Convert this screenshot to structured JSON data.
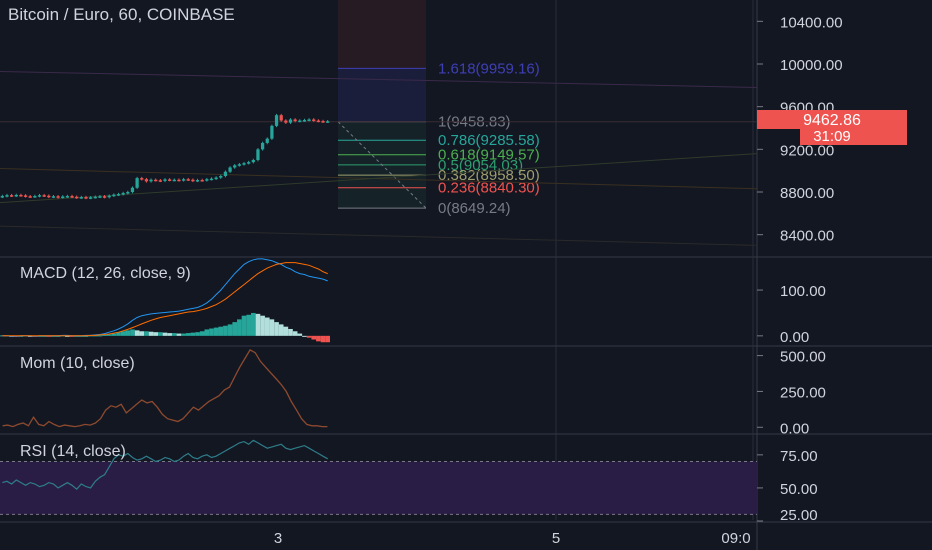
{
  "header": {
    "title": "Bitcoin / Euro, 60, COINBASE"
  },
  "price_pane": {
    "last_price": "9462.86",
    "countdown": "31:09",
    "fib_labels": [
      {
        "text": "1.618(9959.16)",
        "value": 9959.16,
        "color": "#3f3fb5"
      },
      {
        "text": "1(9458.83)",
        "value": 9458.83,
        "color": "#787b86"
      },
      {
        "text": "0.786(9285.58)",
        "value": 9285.58,
        "color": "#26a69a"
      },
      {
        "text": "0.618(9149.57)",
        "value": 9149.57,
        "color": "#4caf50"
      },
      {
        "text": "0.5(9054.03)",
        "value": 9054.03,
        "color": "#2e9e6e"
      },
      {
        "text": "0.382(8958.50)",
        "value": 8958.5,
        "color": "#9e9e6e"
      },
      {
        "text": "0.236(8840.30)",
        "value": 8840.3,
        "color": "#ef5350"
      },
      {
        "text": "0(8649.24)",
        "value": 8649.24,
        "color": "#787b86"
      }
    ]
  },
  "panes": {
    "macd": {
      "label": "MACD (12, 26, close, 9)"
    },
    "mom": {
      "label": "Mom (10, close)"
    },
    "rsi": {
      "label": "RSI (14, close)"
    }
  },
  "x_axis": {
    "ticks": [
      "3",
      "5",
      "09:0"
    ]
  },
  "colors": {
    "up": "#26a69a",
    "down": "#ef5350",
    "macd_line": "#2196f3",
    "signal_line": "#ff6d00",
    "mom_line": "#8d4a2e",
    "rsi_line": "#2e7d8a",
    "rsi_band": "#2a1d45"
  },
  "chart_data": [
    {
      "type": "candlestick",
      "title": "Bitcoin / Euro, 60, COINBASE",
      "ylim": [
        8200,
        10600
      ],
      "yticks": [
        8400,
        8800,
        9200,
        9600,
        10000,
        10400
      ],
      "ytick_labels": [
        "8400.00",
        "8800.00",
        "9200.00",
        "9600.00",
        "10000.00",
        "10400.00"
      ],
      "xticks": [
        "3",
        "5",
        "09:0"
      ],
      "close": [
        8762,
        8770,
        8765,
        8772,
        8768,
        8760,
        8758,
        8762,
        8770,
        8765,
        8755,
        8760,
        8750,
        8758,
        8762,
        8755,
        8748,
        8752,
        8745,
        8750,
        8755,
        8760,
        8752,
        8765,
        8775,
        8780,
        8790,
        8800,
        8840,
        8930,
        8920,
        8900,
        8915,
        8910,
        8905,
        8918,
        8912,
        8915,
        8910,
        8920,
        8915,
        8905,
        8912,
        8910,
        8920,
        8925,
        8935,
        8950,
        8990,
        9030,
        9050,
        9060,
        9070,
        9080,
        9100,
        9200,
        9260,
        9300,
        9420,
        9520,
        9470,
        9450,
        9480,
        9465,
        9470,
        9475,
        9480,
        9470,
        9465,
        9460,
        9462.86
      ],
      "open": [
        8755,
        8762,
        8770,
        8765,
        8772,
        8768,
        8760,
        8758,
        8762,
        8770,
        8765,
        8755,
        8760,
        8750,
        8758,
        8762,
        8755,
        8748,
        8752,
        8745,
        8750,
        8755,
        8760,
        8752,
        8765,
        8775,
        8780,
        8790,
        8800,
        8840,
        8930,
        8920,
        8900,
        8915,
        8910,
        8905,
        8918,
        8912,
        8915,
        8910,
        8920,
        8915,
        8905,
        8912,
        8910,
        8920,
        8925,
        8935,
        8950,
        8990,
        9030,
        9050,
        9060,
        9070,
        9080,
        9100,
        9200,
        9260,
        9300,
        9420,
        9520,
        9470,
        9450,
        9480,
        9465,
        9470,
        9475,
        9480,
        9470,
        9465,
        9460
      ]
    },
    {
      "type": "bar+line",
      "title": "MACD (12, 26, close, 9)",
      "ylim": [
        -20,
        170
      ],
      "yticks": [
        0,
        100
      ],
      "ytick_labels": [
        "0.00",
        "100.00"
      ],
      "histogram": [
        1,
        1,
        0,
        -1,
        0,
        1,
        0,
        -1,
        0,
        0,
        -1,
        0,
        0,
        1,
        0,
        -1,
        0,
        0,
        0,
        1,
        1,
        1,
        2,
        3,
        5,
        8,
        10,
        12,
        14,
        12,
        10,
        10,
        9,
        8,
        8,
        7,
        6,
        6,
        5,
        5,
        6,
        7,
        8,
        10,
        14,
        16,
        18,
        20,
        22,
        25,
        30,
        36,
        44,
        46,
        50,
        48,
        44,
        40,
        36,
        30,
        25,
        20,
        15,
        10,
        5,
        0,
        -4,
        -8,
        -12,
        -14,
        -14
      ],
      "macd": [
        0,
        0,
        -1,
        -1,
        0,
        0,
        0,
        -1,
        0,
        0,
        0,
        0,
        0,
        1,
        1,
        0,
        0,
        0,
        1,
        1,
        2,
        3,
        5,
        8,
        11,
        15,
        20,
        26,
        34,
        40,
        44,
        46,
        48,
        49,
        50,
        51,
        52,
        53,
        54,
        56,
        58,
        60,
        62,
        66,
        72,
        80,
        90,
        100,
        112,
        124,
        136,
        146,
        156,
        162,
        166,
        168,
        168,
        166,
        164,
        160,
        156,
        150,
        146,
        140,
        136,
        134,
        130,
        128,
        126,
        124,
        120
      ],
      "signal": [
        0,
        0,
        0,
        0,
        0,
        0,
        0,
        0,
        0,
        0,
        0,
        0,
        0,
        0,
        0,
        0,
        0,
        0,
        0,
        1,
        1,
        2,
        3,
        4,
        6,
        8,
        11,
        14,
        18,
        22,
        26,
        30,
        34,
        37,
        40,
        42,
        44,
        46,
        48,
        50,
        52,
        53,
        55,
        57,
        60,
        64,
        68,
        74,
        80,
        88,
        96,
        104,
        112,
        120,
        128,
        136,
        142,
        148,
        152,
        156,
        158,
        160,
        160,
        160,
        158,
        156,
        154,
        150,
        146,
        140,
        136
      ]
    },
    {
      "type": "line",
      "title": "Mom (10, close)",
      "ylim": [
        -40,
        560
      ],
      "yticks": [
        0,
        250,
        500
      ],
      "ytick_labels": [
        "0.00",
        "250.00",
        "500.00"
      ],
      "values": [
        10,
        15,
        5,
        20,
        30,
        10,
        70,
        20,
        10,
        40,
        20,
        5,
        15,
        10,
        5,
        10,
        20,
        15,
        30,
        60,
        120,
        150,
        140,
        160,
        100,
        130,
        160,
        190,
        170,
        180,
        140,
        90,
        60,
        50,
        40,
        60,
        100,
        140,
        120,
        150,
        180,
        200,
        220,
        260,
        280,
        350,
        420,
        480,
        540,
        520,
        460,
        420,
        380,
        340,
        300,
        250,
        180,
        120,
        60,
        20,
        10,
        10,
        5,
        5
      ]
    },
    {
      "type": "line",
      "title": "RSI (14, close)",
      "ylim": [
        25,
        90
      ],
      "yticks": [
        25,
        50,
        75
      ],
      "ytick_labels": [
        "25.00",
        "50.00",
        "75.00"
      ],
      "band": [
        30,
        70
      ],
      "values": [
        54,
        55,
        53,
        56,
        54,
        52,
        54,
        53,
        51,
        52,
        54,
        53,
        50,
        52,
        54,
        52,
        49,
        53,
        51,
        50,
        55,
        58,
        60,
        66,
        72,
        75,
        74,
        76,
        73,
        71,
        72,
        74,
        72,
        70,
        71,
        73,
        72,
        70,
        71,
        74,
        76,
        73,
        72,
        74,
        75,
        73,
        74,
        76,
        78,
        80,
        82,
        84,
        85,
        83,
        86,
        84,
        82,
        80,
        81,
        82,
        83,
        80,
        79,
        80,
        81,
        82,
        80,
        78,
        76,
        74,
        72
      ]
    }
  ]
}
